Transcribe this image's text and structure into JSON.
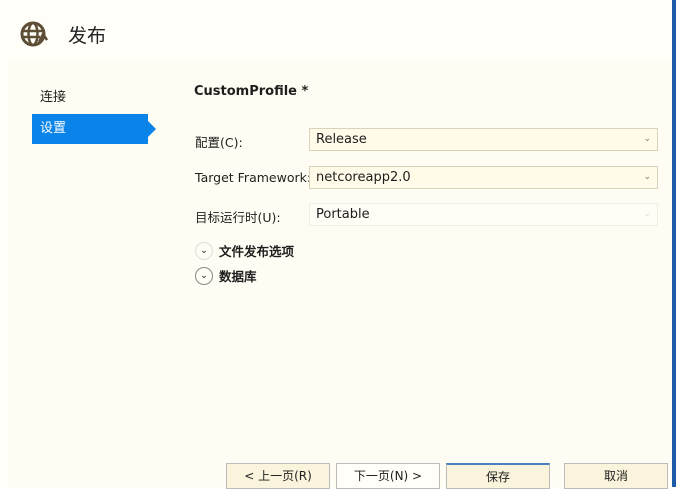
{
  "header": {
    "title": "发布",
    "icon": "globe-publish-icon"
  },
  "sidebar": {
    "items": [
      {
        "label": "连接"
      },
      {
        "label": "设置",
        "active": true
      }
    ]
  },
  "main": {
    "profile_name": "CustomProfile *",
    "fields": [
      {
        "label": "配置(C):",
        "value": "Release"
      },
      {
        "label": "Target Framework:",
        "value": "netcoreapp2.0"
      },
      {
        "label": "目标运行时(U):",
        "value": "Portable",
        "disabled": true
      }
    ],
    "expanders": [
      {
        "label": "文件发布选项"
      },
      {
        "label": "数据库"
      }
    ]
  },
  "footer": {
    "buttons": [
      "< 上一页(R)",
      "下一页(N) >",
      "保存",
      "取消"
    ]
  },
  "colors": {
    "accent": "#0a84e8",
    "background": "#fffdf3"
  }
}
